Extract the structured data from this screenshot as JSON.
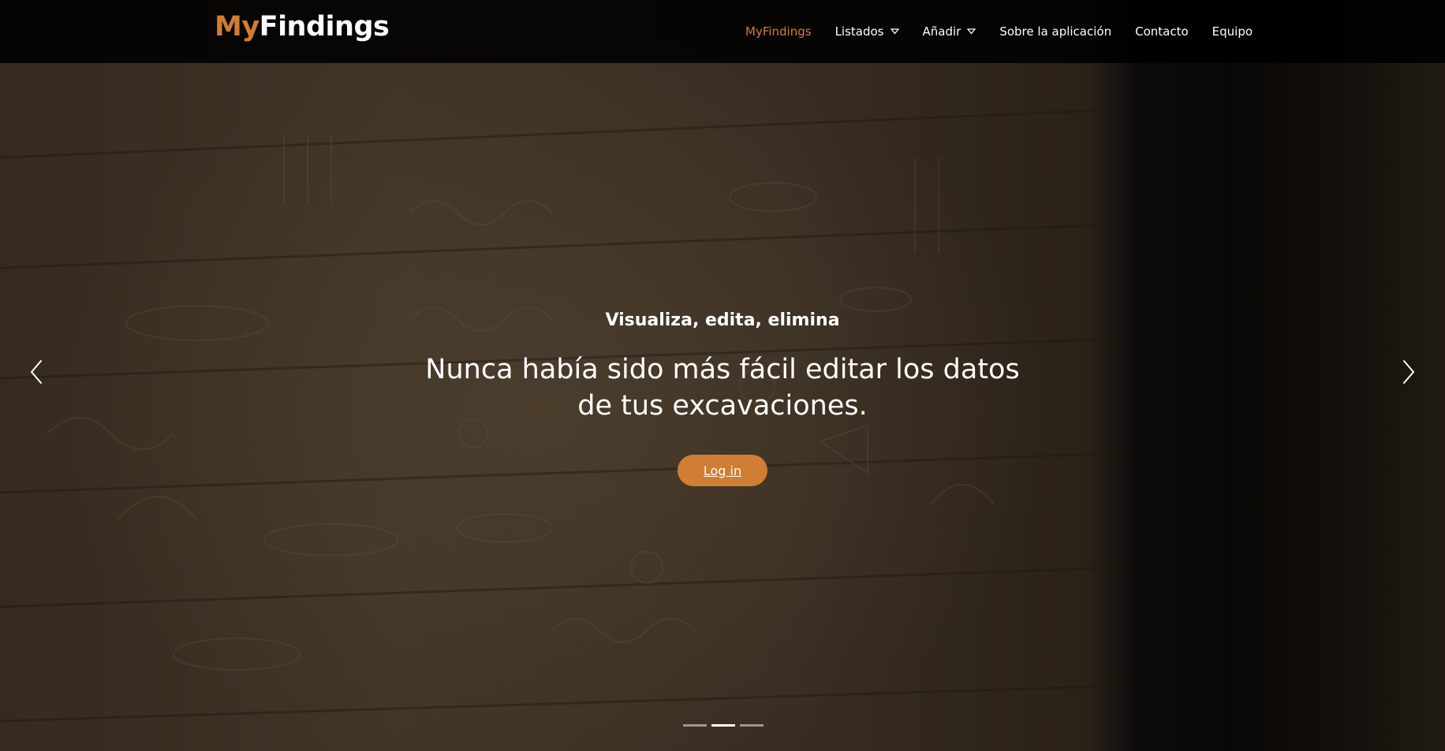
{
  "brand": {
    "part1": "My",
    "part2": "Findings"
  },
  "nav": {
    "items": [
      {
        "label": "MyFindings",
        "active": true,
        "dropdown": false
      },
      {
        "label": "Listados",
        "active": false,
        "dropdown": true
      },
      {
        "label": "Añadir",
        "active": false,
        "dropdown": true
      },
      {
        "label": "Sobre la aplicación",
        "active": false,
        "dropdown": false
      },
      {
        "label": "Contacto",
        "active": false,
        "dropdown": false
      },
      {
        "label": "Equipo",
        "active": false,
        "dropdown": false
      }
    ]
  },
  "hero": {
    "kicker": "Visualiza, edita, elimina",
    "headline": "Nunca había sido más fácil editar los datos de tus excavaciones.",
    "cta_label": "Log in"
  },
  "carousel": {
    "slide_count": 3,
    "active_index": 1,
    "prev_icon": "chevron-left-icon",
    "next_icon": "chevron-right-icon"
  },
  "colors": {
    "accent": "#d07e33",
    "navbar_bg": "#000000",
    "text": "#ffffff"
  }
}
